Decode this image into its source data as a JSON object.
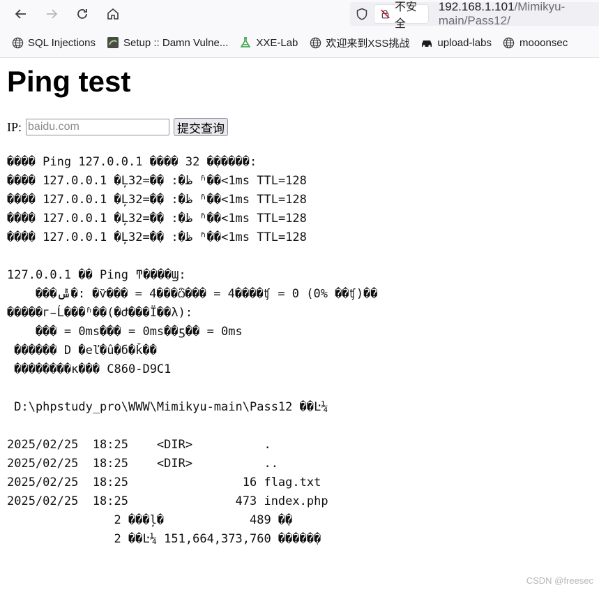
{
  "browser": {
    "insecure_label": "不安全",
    "url_host": "192.168.1.101",
    "url_path": "/Mimikyu-main/Pass12/"
  },
  "bookmarks": [
    {
      "label": "SQL Injections",
      "icon": "globe-icon"
    },
    {
      "label": "Setup :: Damn Vulne...",
      "icon": "dvwa-icon"
    },
    {
      "label": "XXE-Lab",
      "icon": "flask-icon"
    },
    {
      "label": "欢迎来到XSS挑战",
      "icon": "globe-icon"
    },
    {
      "label": "upload-labs",
      "icon": "car-icon"
    },
    {
      "label": "mooonsec",
      "icon": "globe-icon"
    }
  ],
  "page": {
    "title": "Ping test",
    "ip_label": "IP:",
    "ip_placeholder": "baidu.com",
    "submit_label": "提交查询",
    "output_lines": [
      "���� Ping 127.0.0.1 ���� 32 �ֽ�����:",
      "���� 127.0.0.1 �Ļظ�: �ֽ�=32 ʱ��<1ms TTL=128",
      "���� 127.0.0.1 �Ļظ�: �ֽ�=32 ʱ��<1ms TTL=128",
      "���� 127.0.0.1 �Ļظ�: �ֽ�=32 ʱ��<1ms TTL=128",
      "���� 127.0.0.1 �Ļظ�: �ֽ�=32 ʱ��<1ms TTL=128",
      "",
      "127.0.0.1 �� Ping ͳ����Ϣ:",
      "    ���ݰ�: �ѷ��� = 4���ѽ��� = 4����ʧ = 0 (0% ��ʧ)��",
      "�����г̵Ĺ���ʱ��(�Ժ���Ϊ��λ):",
      "    ��� = 0ms��� = 0ms��ƽ�� = 0ms",
      " ������ D �еľ�û�б�ǩ��",
      " ��������к��� C860-D9C1",
      "",
      " D:\\phpstudy_pro\\WWW\\Mimikyu-main\\Pass12 ��Ŀ¼",
      "",
      "2025/02/25  18:25    <DIR>          .",
      "2025/02/25  18:25    <DIR>          ..",
      "2025/02/25  18:25                16 flag.txt",
      "2025/02/25  18:25               473 index.php",
      "               2 ���ļ�            489 �ֽ�",
      "               2 ��Ŀ¼ 151,664,373,760 �����ֽ�"
    ]
  },
  "watermark": "CSDN @freesec"
}
